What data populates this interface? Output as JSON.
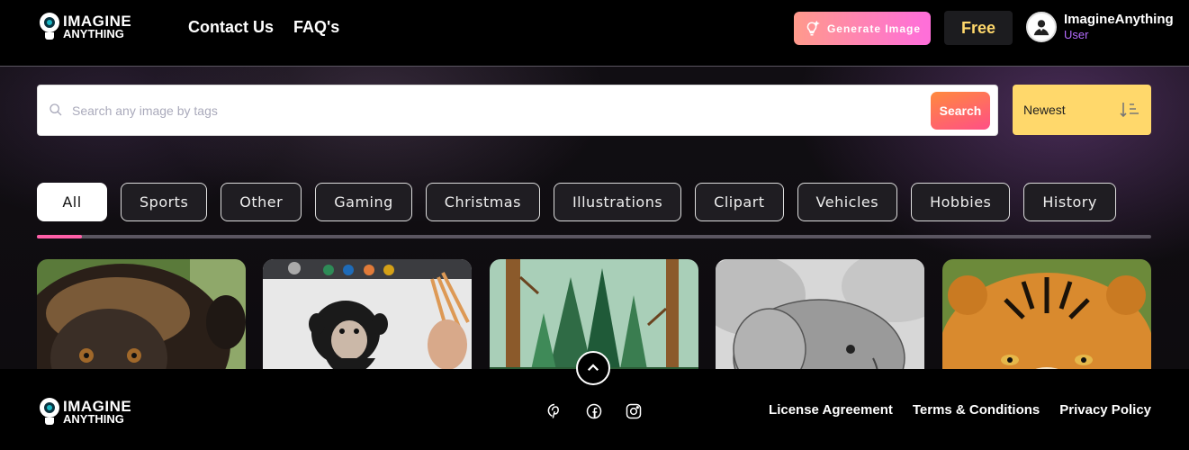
{
  "brand": {
    "line1": "IMAGINE",
    "line2": "ANYTHING"
  },
  "nav": {
    "contact": "Contact Us",
    "faq": "FAQ's"
  },
  "header": {
    "generate_label": "Generate Image",
    "plan_label": "Free",
    "user_name": "ImagineAnything",
    "user_role": "User"
  },
  "search": {
    "placeholder": "Search any image by tags",
    "button": "Search"
  },
  "sort": {
    "label": "Newest"
  },
  "tags": [
    "All",
    "Sports",
    "Other",
    "Gaming",
    "Christmas",
    "Illustrations",
    "Clipart",
    "Vehicles",
    "Hobbies",
    "History"
  ],
  "active_tag": "All",
  "tag_scroll_progress": 0.04,
  "gallery": [
    {
      "subject": "monkey"
    },
    {
      "subject": "chimpanzee drawing"
    },
    {
      "subject": "forest"
    },
    {
      "subject": "elephant sketch"
    },
    {
      "subject": "tiger"
    }
  ],
  "footer": {
    "links": [
      "License Agreement",
      "Terms & Conditions",
      "Privacy Policy"
    ],
    "social_icons": [
      "pinterest-icon",
      "facebook-icon",
      "instagram-icon"
    ]
  },
  "colors": {
    "accent_pink": "#ff5fa8",
    "sort_yellow": "#ffd86b",
    "role_purple": "#b56cff"
  }
}
